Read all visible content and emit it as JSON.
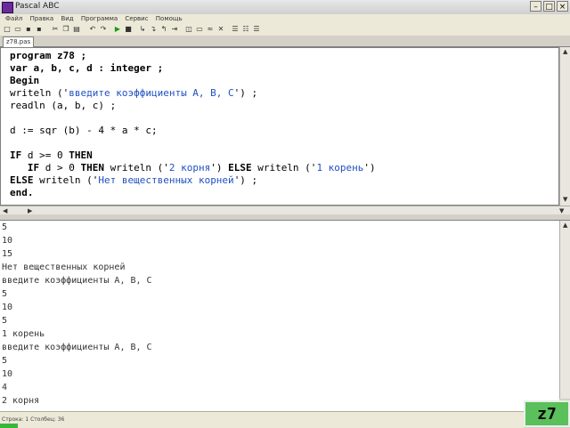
{
  "window": {
    "title": "Pascal ABC"
  },
  "menu": {
    "items": [
      "Файл",
      "Правка",
      "Вид",
      "Программа",
      "Сервис",
      "Помощь"
    ]
  },
  "tabs": [
    {
      "label": "z78.pas"
    }
  ],
  "editor": {
    "lines": [
      {
        "segments": [
          {
            "t": "program z78 ;",
            "k": "kw"
          }
        ]
      },
      {
        "segments": [
          {
            "t": "var a, b, c, d : integer ;",
            "k": "kw"
          }
        ]
      },
      {
        "segments": [
          {
            "t": "Begin",
            "k": "kw"
          }
        ]
      },
      {
        "segments": [
          {
            "t": "writeln ('",
            "k": ""
          },
          {
            "t": "введите коэффициенты A, B, C",
            "k": "str"
          },
          {
            "t": "') ;",
            "k": ""
          }
        ]
      },
      {
        "segments": [
          {
            "t": "readln (a, b, c) ;",
            "k": ""
          }
        ]
      },
      {
        "segments": [
          {
            "t": "",
            "k": ""
          }
        ]
      },
      {
        "segments": [
          {
            "t": "d := sqr (b) - 4 * a * c;",
            "k": ""
          }
        ]
      },
      {
        "segments": [
          {
            "t": "",
            "k": ""
          }
        ]
      },
      {
        "segments": [
          {
            "t": "IF",
            "k": "kw"
          },
          {
            "t": " d >= 0 ",
            "k": ""
          },
          {
            "t": "THEN",
            "k": "kw"
          }
        ]
      },
      {
        "segments": [
          {
            "t": "   IF",
            "k": "kw"
          },
          {
            "t": " d > 0 ",
            "k": ""
          },
          {
            "t": "THEN",
            "k": "kw"
          },
          {
            "t": " writeln ('",
            "k": ""
          },
          {
            "t": "2 корня",
            "k": "str"
          },
          {
            "t": "') ",
            "k": ""
          },
          {
            "t": "ELSE",
            "k": "kw"
          },
          {
            "t": " writeln ('",
            "k": ""
          },
          {
            "t": "1 корень",
            "k": "str"
          },
          {
            "t": "')",
            "k": ""
          }
        ]
      },
      {
        "segments": [
          {
            "t": "ELSE",
            "k": "kw"
          },
          {
            "t": " writeln ('",
            "k": ""
          },
          {
            "t": "Нет вещественных корней",
            "k": "str"
          },
          {
            "t": "') ;",
            "k": ""
          }
        ]
      },
      {
        "segments": [
          {
            "t": "end.",
            "k": "kw"
          }
        ]
      }
    ]
  },
  "output": {
    "lines": [
      "5",
      "10",
      "15",
      "Нет вещественных корней",
      "введите коэффициенты A, B, C",
      "5",
      "10",
      "5",
      "1 корень",
      "введите коэффициенты A, B, C",
      "5",
      "10",
      "4",
      "2 корня"
    ]
  },
  "status": {
    "text": "Строка: 1  Столбец: 36"
  },
  "badge": {
    "label": "z7"
  },
  "colors": {
    "string": "#2050c0",
    "badge": "#5bbf5b",
    "status_green": "#38b838"
  }
}
